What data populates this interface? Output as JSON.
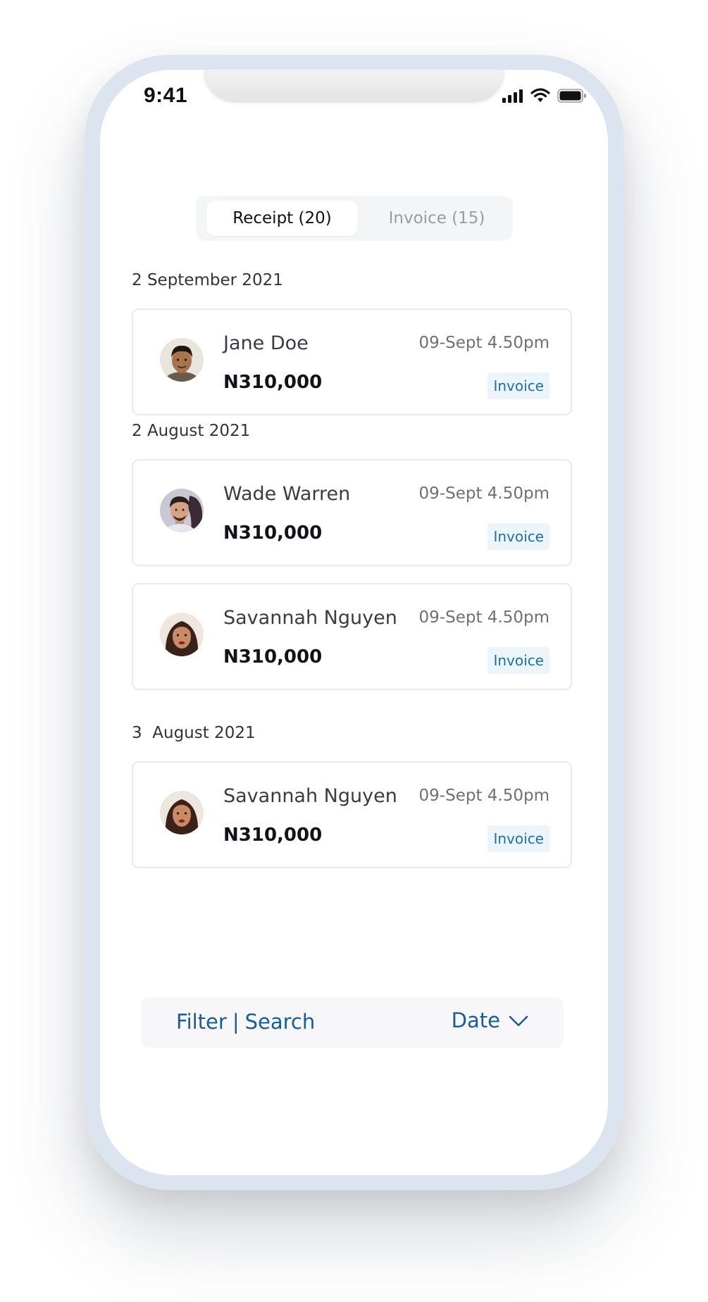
{
  "status_bar": {
    "time": "9:41",
    "icons": [
      "signal-icon",
      "wifi-icon",
      "battery-icon"
    ]
  },
  "tabs": [
    {
      "label": "Receipt (20)",
      "active": true
    },
    {
      "label": "Invoice (15)",
      "active": false
    }
  ],
  "groups": [
    {
      "date": "2 September 2021",
      "items": [
        {
          "name": "Jane Doe",
          "amount": "N310,000",
          "time": "09-Sept 4.50pm",
          "badge": "Invoice"
        }
      ]
    },
    {
      "date": "2 August 2021",
      "items": [
        {
          "name": "Wade Warren",
          "amount": "N310,000",
          "time": "09-Sept 4.50pm",
          "badge": "Invoice"
        },
        {
          "name": "Savannah Nguyen",
          "amount": "N310,000",
          "time": "09-Sept 4.50pm",
          "badge": "Invoice"
        }
      ]
    },
    {
      "date": "3  August 2021",
      "items": [
        {
          "name": "Savannah Nguyen",
          "amount": "N310,000",
          "time": "09-Sept 4.50pm",
          "badge": "Invoice"
        }
      ]
    }
  ],
  "bottom_bar": {
    "filter_label": "Filter",
    "separator": "|",
    "search_label": "Search",
    "sort_label": "Date",
    "sort_icon": "chevron-down-icon"
  },
  "colors": {
    "accent": "#1a5d93",
    "badge_bg": "#ebf5fb",
    "badge_text": "#1f6fa8",
    "frame": "#dbe4ef"
  }
}
